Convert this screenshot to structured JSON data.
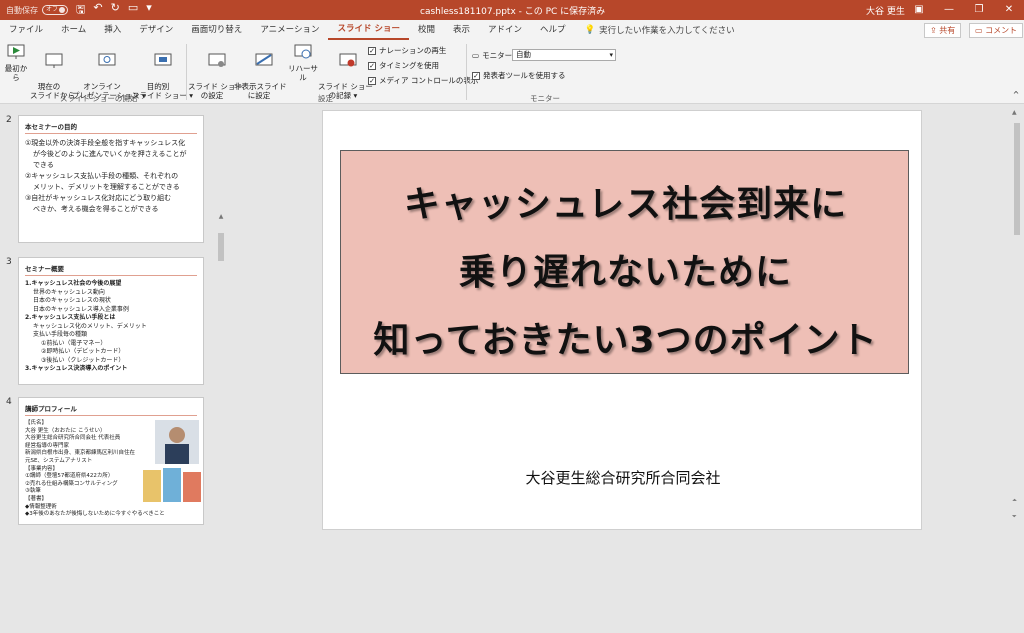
{
  "titlebar": {
    "autosave_label": "自動保存",
    "autosave_state": "オフ",
    "document_title": "cashless181107.pptx - この PC に保存済み",
    "user_name": "大谷 更生"
  },
  "tabs": [
    "ファイル",
    "ホーム",
    "挿入",
    "デザイン",
    "画面切り替え",
    "アニメーション",
    "スライド ショー",
    "校閲",
    "表示",
    "アドイン",
    "ヘルプ"
  ],
  "active_tab": "スライド ショー",
  "search_placeholder": "実行したい作業を入力してください",
  "share_label": "共有",
  "comment_label": "コメント",
  "ribbon": {
    "group_start": {
      "label": "スライド ショーの開始",
      "from_beginning": "最初から",
      "from_current": "現在の\nスライドから",
      "online": "オンライン\nプレゼンテーション ▾",
      "custom": "目的別\nスライド ショー ▾"
    },
    "group_setup": {
      "label": "設定",
      "setup_show": "スライド ショー\nの設定",
      "hide_slide": "非表示スライド\nに設定",
      "rehearse": "リハーサル",
      "record": "スライド ショー\nの記録 ▾",
      "narration": "ナレーションの再生",
      "timing": "タイミングを使用",
      "media_controls": "メディア コントロールの表示"
    },
    "group_monitor": {
      "label": "モニター",
      "monitor_label": "モニター:",
      "monitor_value": "自動",
      "presenter_view": "発表者ツールを使用する"
    }
  },
  "thumbnails": {
    "s2": {
      "number": "2",
      "title": "本セミナーの目的",
      "lines": [
        "①現金以外の決済手段全般を指すキャッシュレス化",
        "が今後どのように進んでいくかを押さえることが",
        "できる",
        "②キャッシュレス支払い手段の種類、それぞれの",
        "メリット、デメリットを理解することができる",
        "③自社がキャッシュレス化対応にどう取り組む",
        "べきか、考える機会を得ることができる"
      ]
    },
    "s3": {
      "number": "3",
      "title": "セミナー概要",
      "lines": [
        "1.キャッシュレス社会の今後の展望",
        "世界のキャッシュレス動向",
        "日本のキャッシュレスの現状",
        "日本のキャッシュレス導入企業事例",
        "2.キャッシュレス支払い手段とは",
        "キャッシュレス化のメリット、デメリット",
        "支払い手段毎の種類",
        "①前払い（電子マネー）",
        "②即時払い（デビットカード）",
        "③後払い（クレジットカード）",
        "3.キャッシュレス決済導入のポイント"
      ]
    },
    "s4": {
      "number": "4",
      "title": "講師プロフィール",
      "lines": [
        "【氏名】",
        "大谷 更生（おおたに こうせい）",
        "大谷更生総合研究所合同会社 代表社員",
        "経営指導の専門家",
        "新潟県白根市出身、東京都練馬区利川自住在",
        "元SE、システムアナリスト",
        "【事業内容】",
        "①講師（登壇57都道府県422カ所）",
        "②売れる仕組み構築コンサルティング",
        "③執筆",
        "【著書】",
        "◆情報整理術",
        "◆3年後のあなたが後悔しないために今すぐやるべきこと"
      ]
    }
  },
  "slide": {
    "title_lines": [
      "キャッシュレス社会到来に",
      "乗り遅れないために",
      "知っておきたい3つのポイント"
    ],
    "subtitle": "大谷更生総合研究所合同会社"
  }
}
